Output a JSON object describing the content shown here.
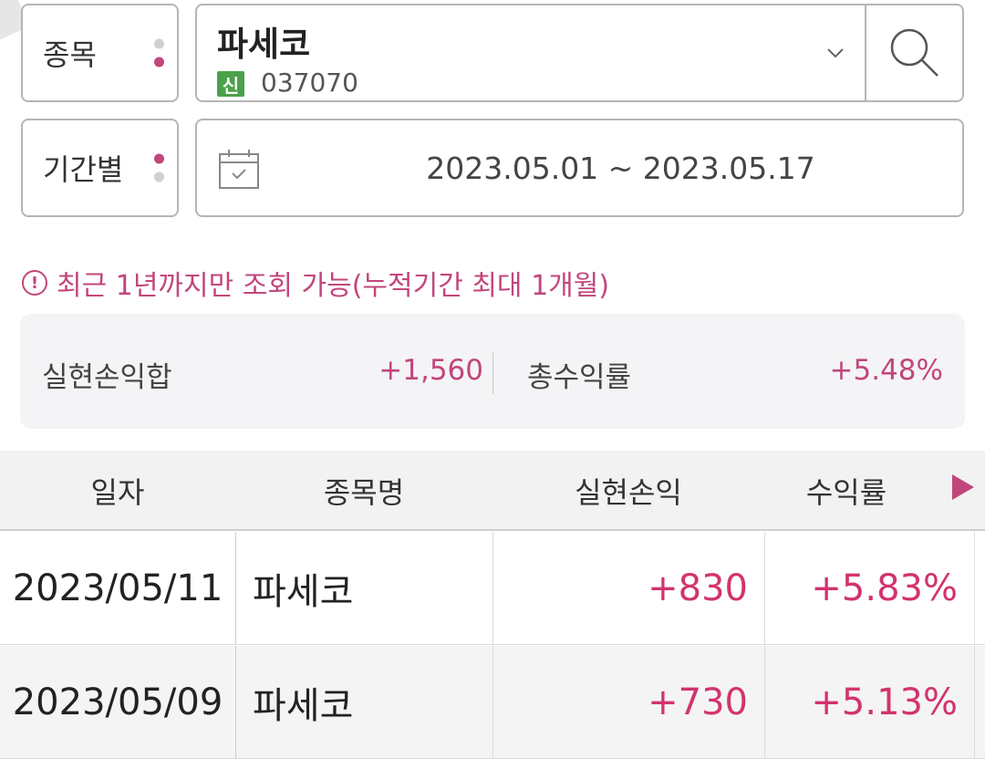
{
  "filters": {
    "stock_label": "종목",
    "period_label": "기간별",
    "stock_name": "파세코",
    "stock_badge": "신",
    "stock_code": "037070",
    "date_range": "2023.05.01 ~ 2023.05.17"
  },
  "notice": {
    "icon": "!",
    "text": "최근 1년까지만 조회 가능(누적기간 최대 1개월)"
  },
  "summary": {
    "realized_label": "실현손익합",
    "realized_value": "+1,560",
    "return_label": "총수익률",
    "return_value": "+5.48%"
  },
  "table": {
    "headers": [
      "일자",
      "종목명",
      "실현손익",
      "수익률"
    ],
    "rows": [
      {
        "date": "2023/05/11",
        "name": "파세코",
        "profit": "+830",
        "rate": "+5.83%"
      },
      {
        "date": "2023/05/09",
        "name": "파세코",
        "profit": "+730",
        "rate": "+5.13%"
      }
    ]
  },
  "colors": {
    "accent": "#c2467c",
    "positive": "#d2336e",
    "badge": "#4aa14a"
  }
}
